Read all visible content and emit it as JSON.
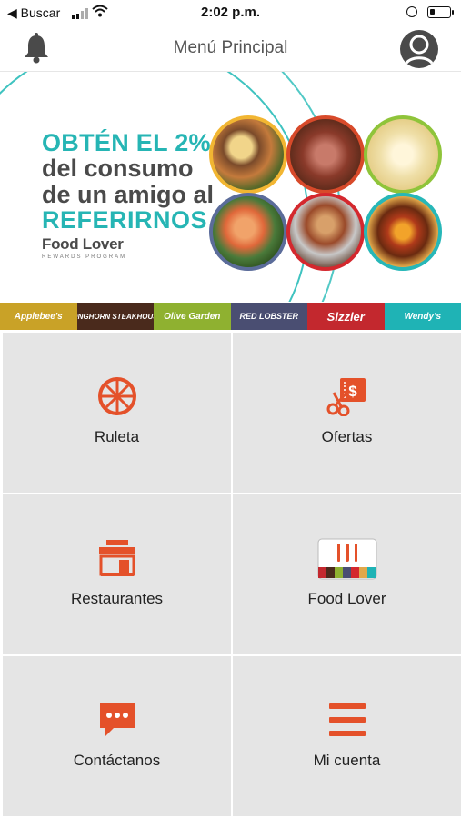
{
  "status_bar": {
    "back_label": "◀ Buscar",
    "time": "2:02 p.m."
  },
  "header": {
    "title": "Menú Principal"
  },
  "banner": {
    "line1": "OBTÉN EL 2%",
    "line2": "del consumo",
    "line3": "de un amigo al",
    "line4": "REFERIRNOS",
    "logo": "Food Lover",
    "logo_sub": "REWARDS PROGRAM"
  },
  "brands": [
    {
      "name": "Applebee's",
      "color": "#c9a227"
    },
    {
      "name": "LONGHORN STEAKHOUSE",
      "color": "#4a2a1c"
    },
    {
      "name": "Olive Garden",
      "color": "#8fb130"
    },
    {
      "name": "RED LOBSTER",
      "color": "#4a4e72"
    },
    {
      "name": "Sizzler",
      "color": "#c3282e"
    },
    {
      "name": "Wendy's",
      "color": "#1fb3b5"
    }
  ],
  "menu": [
    {
      "label": "Ruleta",
      "icon": "wheel-icon"
    },
    {
      "label": "Ofertas",
      "icon": "coupon-icon"
    },
    {
      "label": "Restaurantes",
      "icon": "store-icon"
    },
    {
      "label": "Food Lover",
      "icon": "card-icon"
    },
    {
      "label": "Contáctanos",
      "icon": "chat-icon"
    },
    {
      "label": "Mi cuenta",
      "icon": "menu-icon"
    }
  ],
  "colors": {
    "accent": "#e4512a",
    "teal": "#26b5b4",
    "tile_bg": "#e5e5e5"
  }
}
